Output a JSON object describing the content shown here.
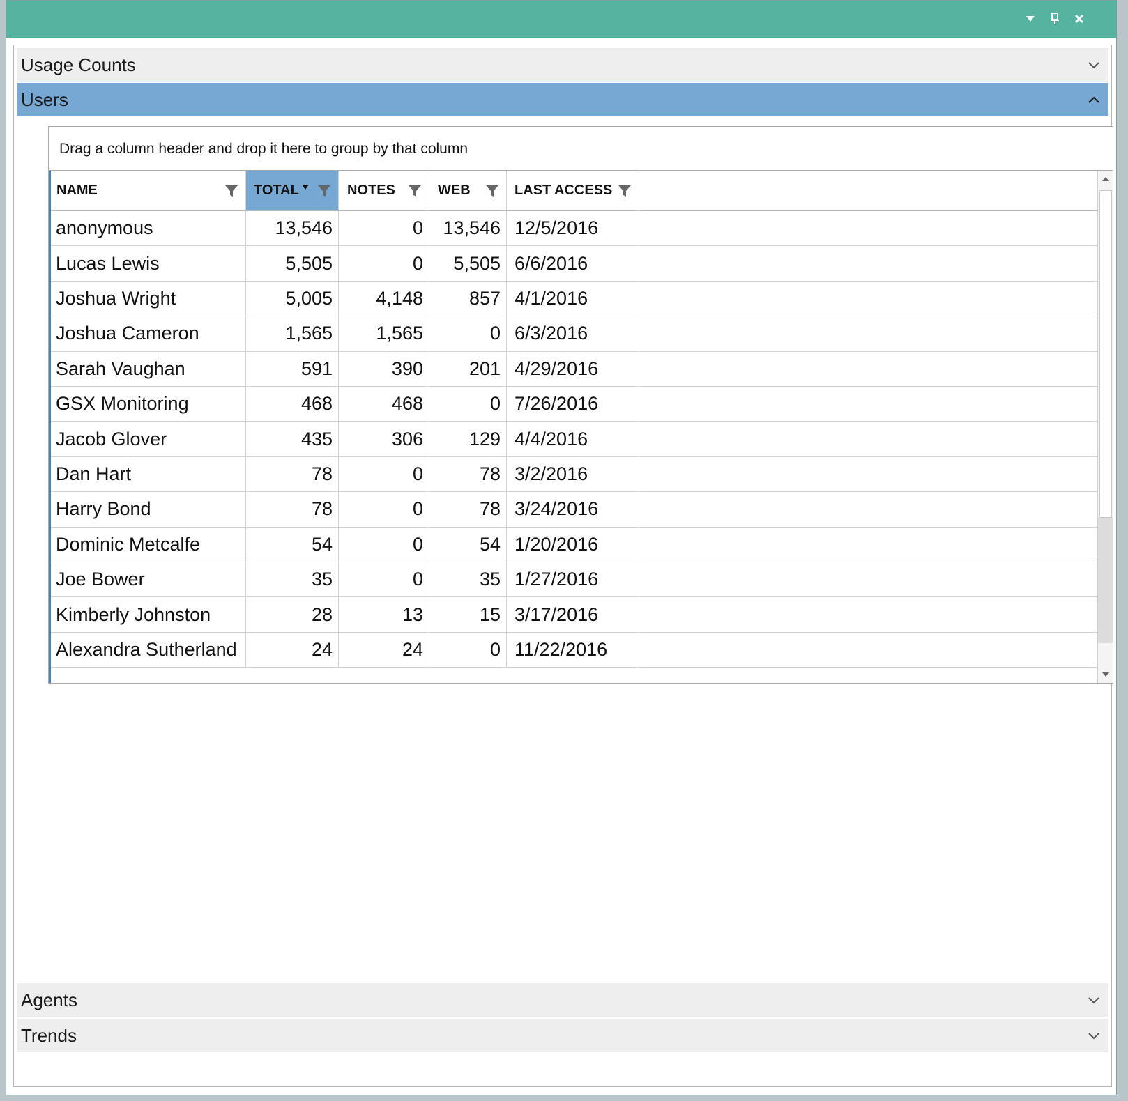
{
  "window": {
    "controls": [
      "dropdown-icon",
      "pin-icon",
      "close-icon"
    ],
    "accent_color": "#56b3a0"
  },
  "sections": {
    "usage_counts": "Usage Counts",
    "users": "Users",
    "agents": "Agents",
    "trends": "Trends",
    "active_color": "#77a8d3"
  },
  "grid": {
    "group_panel_text": "Drag a column header and drop it here to group by that column",
    "columns": {
      "name": "NAME",
      "total": "TOTAL",
      "notes": "NOTES",
      "web": "WEB",
      "last_access": "LAST ACCESS"
    },
    "sorted_column": "total",
    "sort_direction": "descending",
    "rows": [
      {
        "name": "anonymous",
        "total": "13,546",
        "notes": "0",
        "web": "13,546",
        "last_access": "12/5/2016"
      },
      {
        "name": "Lucas Lewis",
        "total": "5,505",
        "notes": "0",
        "web": "5,505",
        "last_access": "6/6/2016"
      },
      {
        "name": "Joshua Wright",
        "total": "5,005",
        "notes": "4,148",
        "web": "857",
        "last_access": "4/1/2016"
      },
      {
        "name": "Joshua Cameron",
        "total": "1,565",
        "notes": "1,565",
        "web": "0",
        "last_access": "6/3/2016"
      },
      {
        "name": "Sarah Vaughan",
        "total": "591",
        "notes": "390",
        "web": "201",
        "last_access": "4/29/2016"
      },
      {
        "name": "GSX Monitoring",
        "total": "468",
        "notes": "468",
        "web": "0",
        "last_access": "7/26/2016"
      },
      {
        "name": "Jacob Glover",
        "total": "435",
        "notes": "306",
        "web": "129",
        "last_access": "4/4/2016"
      },
      {
        "name": "Dan Hart",
        "total": "78",
        "notes": "0",
        "web": "78",
        "last_access": "3/2/2016"
      },
      {
        "name": "Harry Bond",
        "total": "78",
        "notes": "0",
        "web": "78",
        "last_access": "3/24/2016"
      },
      {
        "name": "Dominic Metcalfe",
        "total": "54",
        "notes": "0",
        "web": "54",
        "last_access": "1/20/2016"
      },
      {
        "name": "Joe Bower",
        "total": "35",
        "notes": "0",
        "web": "35",
        "last_access": "1/27/2016"
      },
      {
        "name": "Kimberly Johnston",
        "total": "28",
        "notes": "13",
        "web": "15",
        "last_access": "3/17/2016"
      },
      {
        "name": "Alexandra Sutherland",
        "total": "24",
        "notes": "24",
        "web": "0",
        "last_access": "11/22/2016"
      }
    ]
  }
}
